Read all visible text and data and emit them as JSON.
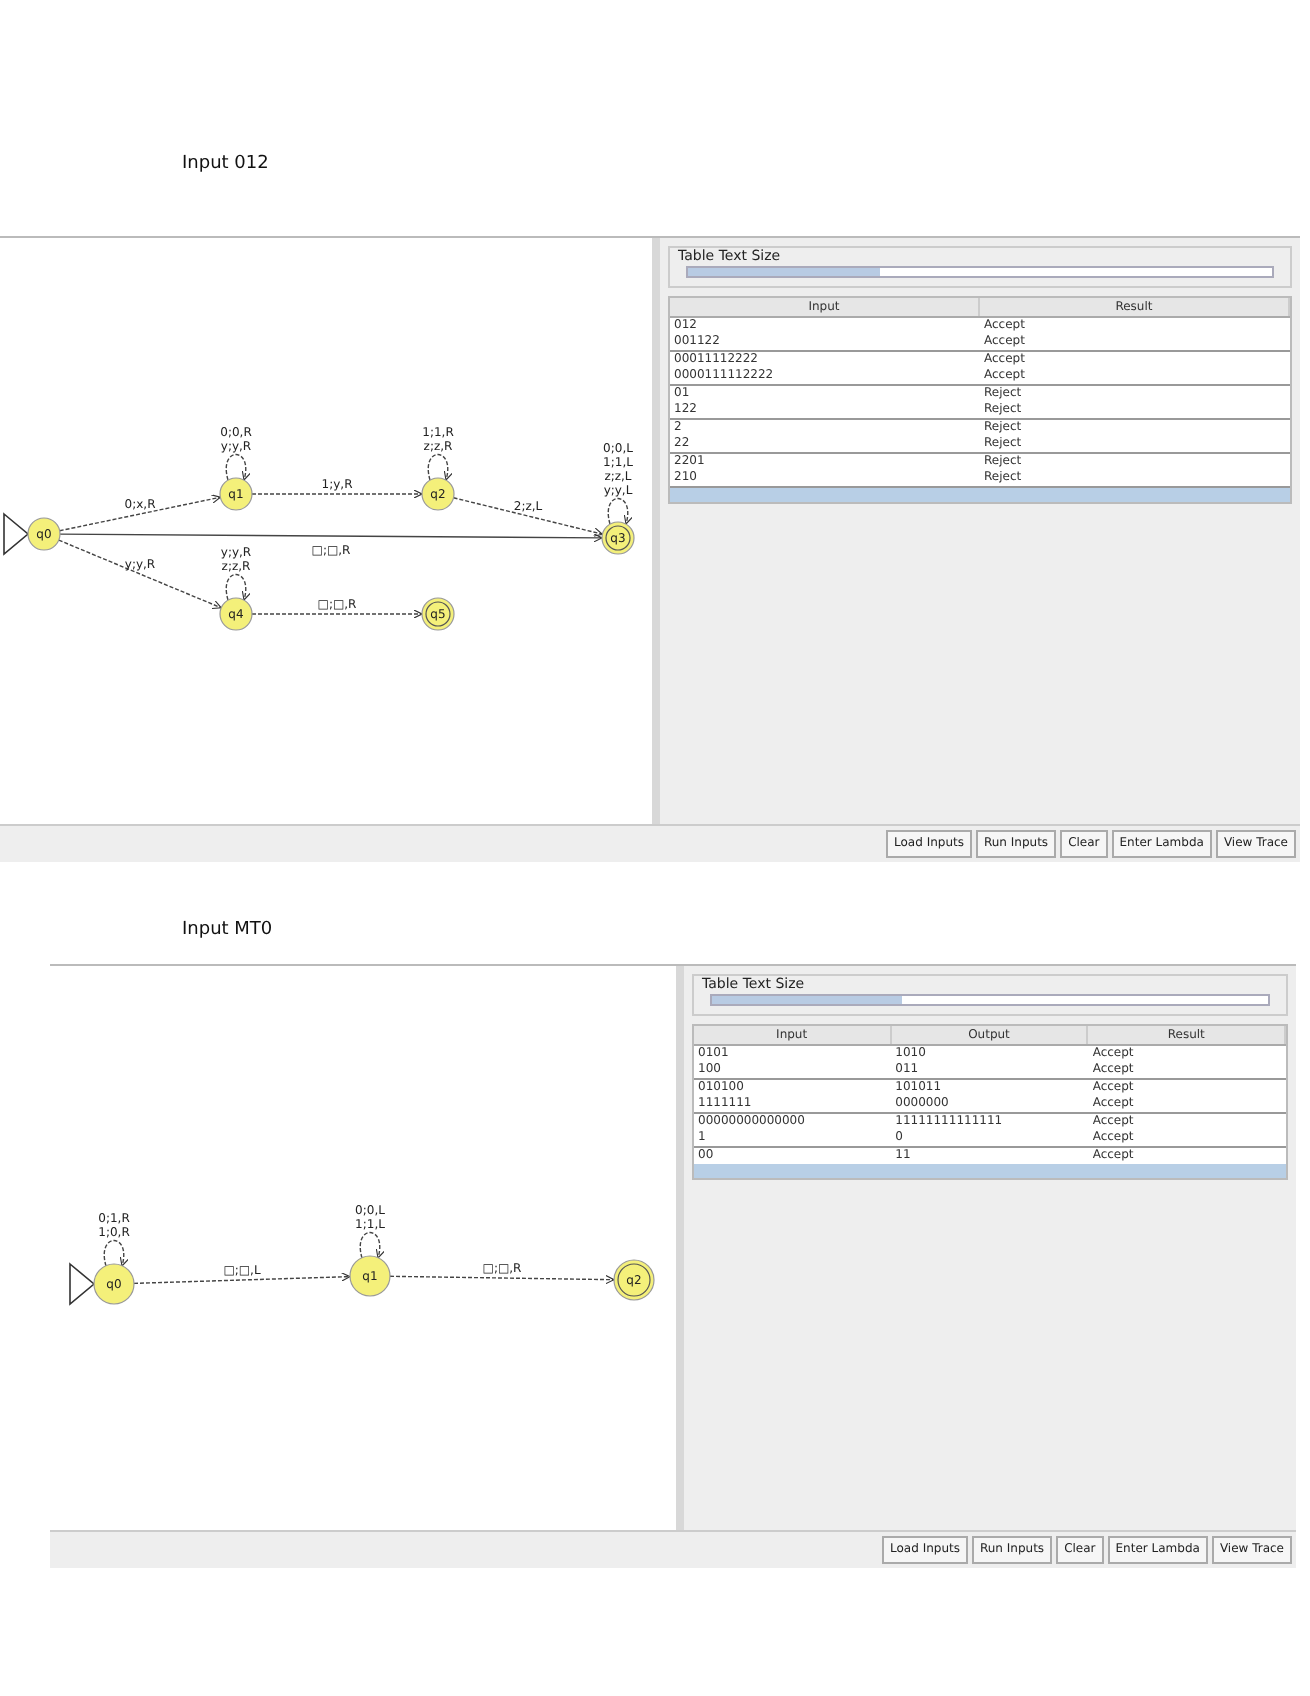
{
  "documents": [
    {
      "title": "Input 012",
      "diagram": {
        "states": [
          {
            "label": "q0",
            "start": true,
            "final": false
          },
          {
            "label": "q1",
            "start": false,
            "final": false
          },
          {
            "label": "q2",
            "start": false,
            "final": false
          },
          {
            "label": "q3",
            "start": false,
            "final": true
          },
          {
            "label": "q4",
            "start": false,
            "final": false
          },
          {
            "label": "q5",
            "start": false,
            "final": true
          }
        ],
        "transitions": [
          {
            "labels": [
              "0;x,R"
            ]
          },
          {
            "labels": [
              "1;y,R"
            ]
          },
          {
            "labels": [
              "2;z,L"
            ]
          },
          {
            "labels": [
              "□;□,R"
            ]
          },
          {
            "labels": [
              "y;y,R"
            ]
          },
          {
            "labels": [
              "□;□,R"
            ]
          },
          {
            "labels": [
              "0;0,R",
              "y;y,R"
            ]
          },
          {
            "labels": [
              "1;1,R",
              "z;z,R"
            ]
          },
          {
            "labels": [
              "0;0,L",
              "1;1,L",
              "z;z,L",
              "y;y,L"
            ]
          },
          {
            "labels": [
              "y;y,R",
              "z;z,R"
            ]
          }
        ]
      },
      "slider": {
        "label": "Table Text Size",
        "level": 0.33
      },
      "table": {
        "columns": [
          "Input",
          "Result"
        ],
        "rows": [
          {
            "cells": [
              "012",
              "Accept"
            ]
          },
          {
            "cells": [
              "001122",
              "Accept"
            ]
          },
          {
            "cells": [
              "00011112222",
              "Accept"
            ]
          },
          {
            "cells": [
              "0000111112222",
              "Accept"
            ]
          },
          {
            "cells": [
              "01",
              "Reject"
            ]
          },
          {
            "cells": [
              "122",
              "Reject"
            ]
          },
          {
            "cells": [
              "2",
              "Reject"
            ]
          },
          {
            "cells": [
              "22",
              "Reject"
            ]
          },
          {
            "cells": [
              "2201",
              "Reject"
            ]
          },
          {
            "cells": [
              "210",
              "Reject"
            ]
          }
        ]
      },
      "buttons": [
        "Load Inputs",
        "Run Inputs",
        "Clear",
        "Enter Lambda",
        "View Trace"
      ]
    },
    {
      "title": "Input MT0",
      "diagram": {
        "states": [
          {
            "label": "q0",
            "start": true,
            "final": false
          },
          {
            "label": "q1",
            "start": false,
            "final": false
          },
          {
            "label": "q2",
            "start": false,
            "final": true
          }
        ],
        "transitions": [
          {
            "labels": [
              "□;□,L"
            ]
          },
          {
            "labels": [
              "□;□,R"
            ]
          },
          {
            "labels": [
              "0;1,R",
              "1;0,R"
            ]
          },
          {
            "labels": [
              "0;0,L",
              "1;1,L"
            ]
          }
        ]
      },
      "slider": {
        "label": "Table Text Size",
        "level": 0.34
      },
      "table": {
        "columns": [
          "Input",
          "Output",
          "Result"
        ],
        "rows": [
          {
            "cells": [
              "0101",
              "1010",
              "Accept"
            ]
          },
          {
            "cells": [
              "100",
              "011",
              "Accept"
            ]
          },
          {
            "cells": [
              "010100",
              "101011",
              "Accept"
            ]
          },
          {
            "cells": [
              "1111111",
              "0000000",
              "Accept"
            ]
          },
          {
            "cells": [
              "00000000000000",
              "11111111111111",
              "Accept"
            ]
          },
          {
            "cells": [
              "1",
              "0",
              "Accept"
            ]
          },
          {
            "cells": [
              "00",
              "11",
              "Accept"
            ]
          }
        ]
      },
      "buttons": [
        "Load Inputs",
        "Run Inputs",
        "Clear",
        "Enter Lambda",
        "View Trace"
      ]
    }
  ]
}
